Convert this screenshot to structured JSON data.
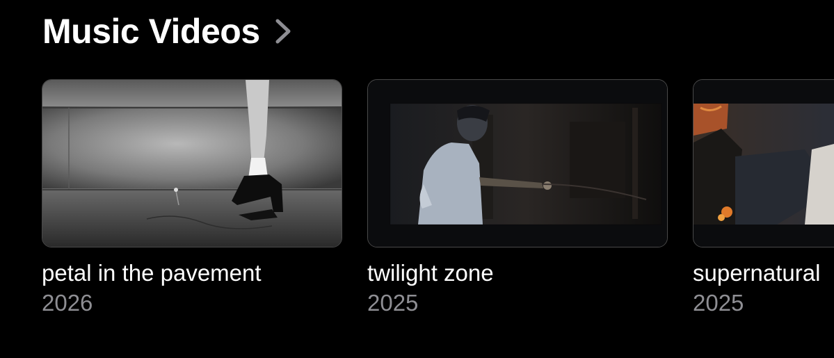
{
  "section": {
    "title": "Music Videos",
    "chevron_icon": "chevron-right-icon"
  },
  "colors": {
    "background": "#000000",
    "title": "#ffffff",
    "subtitle": "#8e8e93",
    "thumb_border": "#4a4a4a"
  },
  "videos": [
    {
      "title": "petal in the pavement",
      "year": "2026"
    },
    {
      "title": "twilight zone",
      "year": "2025"
    },
    {
      "title": "supernatural",
      "year": "2025"
    }
  ]
}
